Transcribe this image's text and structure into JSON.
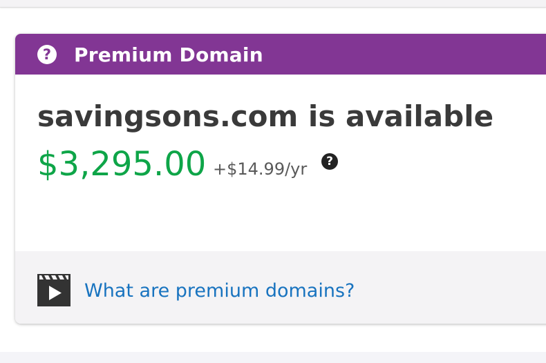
{
  "header": {
    "icon": "help-circle-icon",
    "icon_glyph": "?",
    "title": "Premium Domain",
    "color": "#823694"
  },
  "domain": {
    "availability_text": "savingsons.com is available",
    "price": "$3,295.00",
    "renewal": "+$14.99/yr",
    "renewal_help_glyph": "?",
    "price_color": "#0ea548"
  },
  "footer": {
    "icon": "video-icon",
    "link_label": "What are premium domains?",
    "link_color": "#1873bf"
  }
}
